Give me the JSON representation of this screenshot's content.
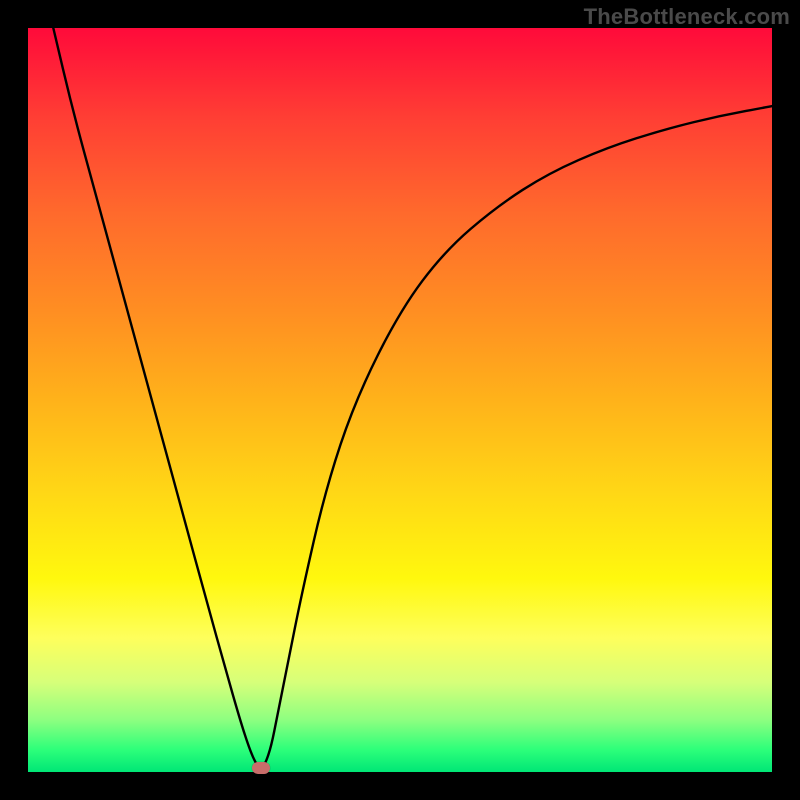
{
  "watermark": "TheBottleneck.com",
  "chart_data": {
    "type": "line",
    "title": "",
    "xlabel": "",
    "ylabel": "",
    "xlim": [
      0,
      100
    ],
    "ylim": [
      0,
      100
    ],
    "gradient_note": "vertical spectrum red→green as y decreases",
    "series": [
      {
        "name": "curve",
        "x": [
          3.4,
          6,
          9,
          12,
          15,
          18,
          21,
          24,
          26.5,
          28.5,
          29.8,
          30.7,
          31.3,
          31.9,
          32.7,
          33.5,
          34.9,
          36.8,
          40,
          44,
          50,
          56,
          63,
          70,
          78,
          86,
          93,
          100
        ],
        "y": [
          100,
          89,
          78,
          67,
          56,
          45,
          34,
          23,
          14,
          7,
          3,
          1,
          0.5,
          1.1,
          3.5,
          7.5,
          14.5,
          24,
          38,
          50,
          62,
          70,
          76,
          80.5,
          84,
          86.5,
          88.2,
          89.5
        ]
      }
    ],
    "marker": {
      "x": 31.3,
      "y": 0.5
    }
  },
  "colors": {
    "curve": "#000000",
    "marker": "#c86d6a",
    "frame": "#000000"
  }
}
